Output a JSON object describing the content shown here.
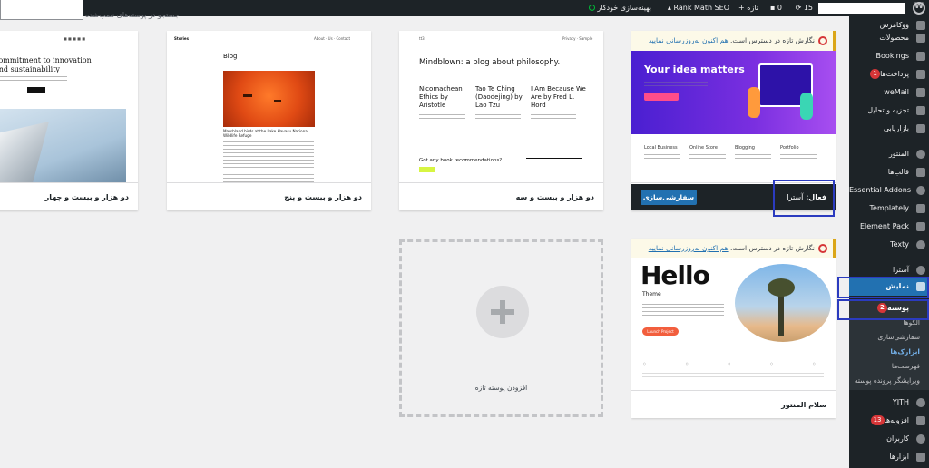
{
  "adminbar": {
    "site_name": "",
    "updates_count": "15",
    "comments_count": "0",
    "new_label": "تازه",
    "rankmath_label": "Rank Math SEO",
    "optimize_label": "بهینه‌سازی خودکار"
  },
  "page": {
    "search_placeholder": "جستجو در پوسته‌های نصب‌شده"
  },
  "sidebar": {
    "items": [
      {
        "label": "ووکامرس"
      },
      {
        "label": "محصولات"
      },
      {
        "label": "Bookings"
      },
      {
        "label": "پرداخت‌ها",
        "badge": "1"
      },
      {
        "label": "weMail"
      },
      {
        "label": "تجزیه و تحلیل"
      },
      {
        "label": "بازاریابی"
      },
      {
        "label": "المنتور"
      },
      {
        "label": "قالب‌ها"
      },
      {
        "label": "Essential Addons"
      },
      {
        "label": "Templately"
      },
      {
        "label": "Element Pack"
      },
      {
        "label": "Texty"
      },
      {
        "label": "آسترا"
      },
      {
        "label": "نمایش"
      },
      {
        "label": "پوسته",
        "badge": "2"
      },
      {
        "label": "YITH"
      },
      {
        "label": "افزونه‌ها",
        "badge": "13"
      },
      {
        "label": "کاربران"
      },
      {
        "label": "ابزارها"
      }
    ],
    "submenu": [
      {
        "label": "الگوها"
      },
      {
        "label": "سفارشی‌سازی"
      },
      {
        "label": "ابزارک‌ها"
      },
      {
        "label": "فهرست‌ها"
      },
      {
        "label": "ویرایشگر پرونده پوسته"
      }
    ]
  },
  "themes": {
    "t2024": {
      "name": "دو هزار و بیست و چهار",
      "hero": "commitment to innovation and sustainability"
    },
    "t2025": {
      "name": "دو هزار و بیست و پنج",
      "blog_heading": "Blog",
      "brand": "Stories",
      "caption": "Marshland birds at the Lake Havasu National Wildlife Refuge"
    },
    "t2023": {
      "name": "دو هزار و بیست و سه",
      "headline": "Mindblown: a blog about philosophy.",
      "posts": [
        "Nicomachean Ethics by Aristotle",
        "Tao Te Ching (Daodejing) by Lao Tzu",
        "I Am Because We Are by Fred L. Hord"
      ],
      "cta": "Got any book recommendations?"
    },
    "astra": {
      "notice_text": "نگارش تازه در دسترس است.",
      "notice_link": "هم اکنون به‌روزرسانی نمایید",
      "active_prefix": "فعال:",
      "active_name": "آسترا",
      "customize_button": "سفارشی‌سازی",
      "hero_text": "Your idea matters",
      "features": [
        "Local Business",
        "Online Store",
        "Blogging",
        "Portfolio"
      ]
    },
    "hello": {
      "notice_text": "نگارش تازه در دسترس است.",
      "notice_link": "هم اکنون به‌روزرسانی نمایید",
      "name": "سلام المنتور",
      "hero_text": "Hello",
      "sub_text": "Theme",
      "button": "Launch Project"
    }
  },
  "add_theme_label": "افزودن پوسته تازه",
  "colors": {
    "admin_dark": "#1d2327",
    "accent_blue": "#2271b1",
    "highlight_box": "#2b3bbf",
    "badge_red": "#d63638"
  }
}
